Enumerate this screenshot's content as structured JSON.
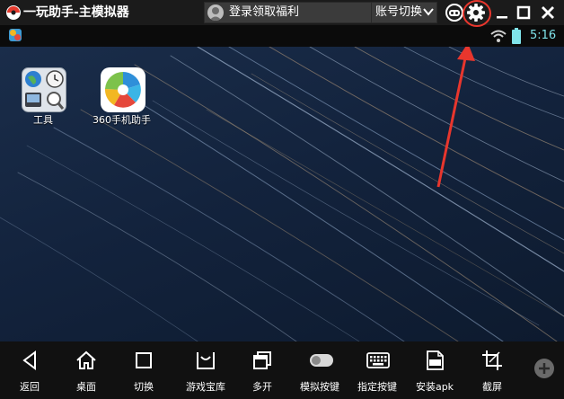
{
  "window": {
    "title": "一玩助手-主模拟器",
    "login_text": "登录领取福利",
    "account_switch_label": "账号切换"
  },
  "statusbar": {
    "time": "5:16"
  },
  "desktop": {
    "icons": [
      {
        "label": "工具",
        "icon": "tools-folder-icon"
      },
      {
        "label": "360手机助手",
        "icon": "app-360-icon"
      }
    ]
  },
  "navbar": {
    "items": [
      {
        "label": "返回",
        "icon": "back-icon"
      },
      {
        "label": "桌面",
        "icon": "home-icon"
      },
      {
        "label": "切换",
        "icon": "recent-apps-icon"
      },
      {
        "label": "游戏宝库",
        "icon": "game-library-icon"
      },
      {
        "label": "多开",
        "icon": "multi-instance-icon"
      },
      {
        "label": "模拟按键",
        "icon": "toggle-icon"
      },
      {
        "label": "指定按键",
        "icon": "keyboard-icon"
      },
      {
        "label": "安装apk",
        "icon": "apk-icon"
      },
      {
        "label": "截屏",
        "icon": "crop-icon"
      }
    ]
  },
  "colors": {
    "accent_time": "#7fe3ea",
    "arrow": "#e8362d"
  }
}
